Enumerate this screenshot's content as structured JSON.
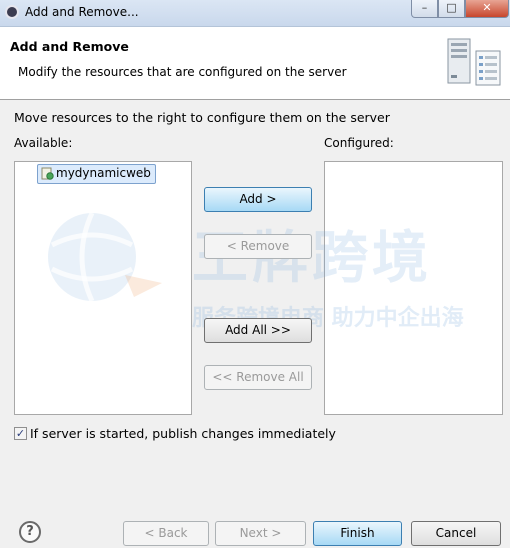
{
  "window": {
    "title": "Add and Remove..."
  },
  "header": {
    "title": "Add and Remove",
    "description": "Modify the resources that are configured on the server"
  },
  "instructions": "Move resources to the right to configure them on the server",
  "available": {
    "label": "Available:",
    "items": [
      {
        "label": "mydynamicweb",
        "selected": true
      }
    ]
  },
  "configured": {
    "label": "Configured:",
    "items": []
  },
  "actions": {
    "add": "Add >",
    "remove": "< Remove",
    "add_all": "Add All >>",
    "remove_all": "<< Remove All"
  },
  "publish": {
    "label": "If server is started, publish changes immediately",
    "checked": true
  },
  "footer": {
    "help_icon": "?",
    "back": "< Back",
    "next": "Next >",
    "finish": "Finish",
    "cancel": "Cancel"
  },
  "watermark": {
    "main": "王牌跨境",
    "sub": "服务跨境电商 助力中企出海"
  },
  "colors": {
    "accent_button": "#a7d9f5",
    "selection": "#dcebfc",
    "title_bar": "#c9d8ec",
    "close_button": "#c7462c"
  }
}
